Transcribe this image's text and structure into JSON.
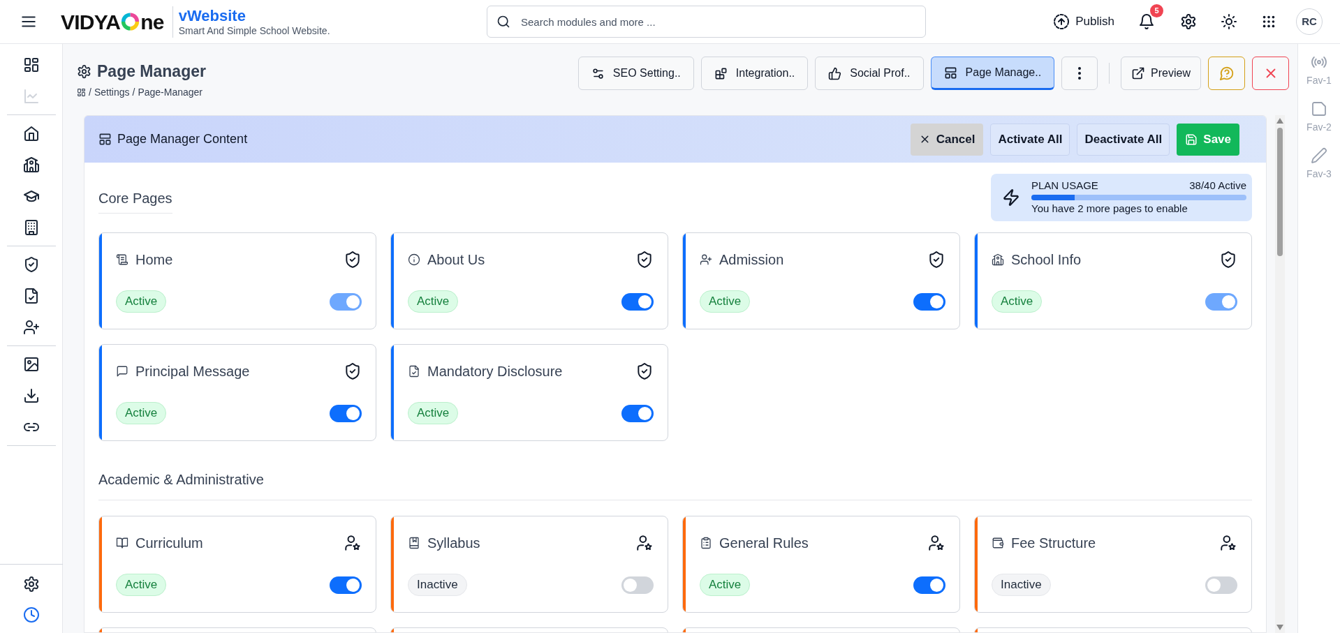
{
  "header": {
    "logo": {
      "before": "VIDYA",
      "after": "ne"
    },
    "app_name": "vWebsite",
    "tagline": "Smart And Simple School Website.",
    "search": {
      "placeholder": "Search modules and more ..."
    },
    "publish": "Publish",
    "notification_count": "5",
    "avatar": "RC"
  },
  "sidebar": {
    "groups": [
      [
        {
          "selected": false,
          "disabled": false
        },
        {
          "selected": false,
          "disabled": true
        }
      ],
      [
        {
          "selected": false,
          "disabled": false
        },
        {
          "selected": false,
          "disabled": false
        },
        {
          "selected": false,
          "disabled": false
        },
        {
          "selected": false,
          "disabled": false
        }
      ],
      [
        {
          "selected": false,
          "disabled": false
        },
        {
          "selected": false,
          "disabled": false
        },
        {
          "selected": false,
          "disabled": false
        }
      ],
      [
        {
          "selected": false,
          "disabled": false
        },
        {
          "selected": false,
          "disabled": false
        },
        {
          "selected": false,
          "disabled": false
        }
      ]
    ],
    "bottom": [
      {
        "selected": false,
        "disabled": false
      },
      {
        "selected": true,
        "disabled": false
      }
    ]
  },
  "page": {
    "title": "Page Manager",
    "breadcrumb": [
      {
        "separator": "/",
        "label": "Settings"
      },
      {
        "separator": "/",
        "label": "Page-Manager"
      }
    ],
    "tabs": [
      {
        "label": "SEO Setting..",
        "selected": false
      },
      {
        "label": "Integration..",
        "selected": false
      },
      {
        "label": "Social Prof..",
        "selected": false
      },
      {
        "label": "Page Manage..",
        "selected": true
      }
    ],
    "preview": "Preview"
  },
  "panel": {
    "title": "Page Manager Content",
    "actions": [
      {
        "label": "Cancel",
        "kind": "cancel"
      },
      {
        "label": "Activate All",
        "kind": "plain"
      },
      {
        "label": "Deactivate All",
        "kind": "plain"
      },
      {
        "label": "Save",
        "kind": "save"
      }
    ],
    "sections": [
      {
        "title": "Core Pages",
        "kind": "core",
        "color": "#0d6efd",
        "plan_usage": {
          "label": "PLAN USAGE",
          "count": "38/40 Active",
          "level": 0.2,
          "note": "You have 2 more pages to enable"
        },
        "cards": [
          {
            "title": "Home",
            "kind": "protected",
            "status": "Active",
            "on": true,
            "disabled": true
          },
          {
            "title": "About Us",
            "kind": "protected",
            "status": "Active",
            "on": true,
            "disabled": false
          },
          {
            "title": "Admission",
            "kind": "protected",
            "status": "Active",
            "on": true,
            "disabled": false
          },
          {
            "title": "School Info",
            "kind": "protected",
            "status": "Active",
            "on": true,
            "disabled": true
          },
          {
            "title": "Principal Message",
            "kind": "protected",
            "status": "Active",
            "on": true,
            "disabled": false
          },
          {
            "title": "Mandatory Disclosure",
            "kind": "protected",
            "status": "Active",
            "on": true,
            "disabled": false
          }
        ]
      },
      {
        "title": "Academic & Administrative",
        "kind": "group",
        "color": "#fd6a0d",
        "continues": true,
        "cards": [
          {
            "title": "Curriculum",
            "kind": "role",
            "status": "Active",
            "on": true,
            "disabled": false
          },
          {
            "title": "Syllabus",
            "kind": "role",
            "status": "Inactive",
            "on": false,
            "disabled": false
          },
          {
            "title": "General Rules",
            "kind": "role",
            "status": "Active",
            "on": true,
            "disabled": false
          },
          {
            "title": "Fee Structure",
            "kind": "role",
            "status": "Inactive",
            "on": false,
            "disabled": false
          }
        ]
      }
    ]
  },
  "favorites": [
    {
      "label": "Fav-1",
      "disabled": true
    },
    {
      "label": "Fav-2",
      "disabled": true
    },
    {
      "label": "Fav-3",
      "disabled": true
    }
  ]
}
